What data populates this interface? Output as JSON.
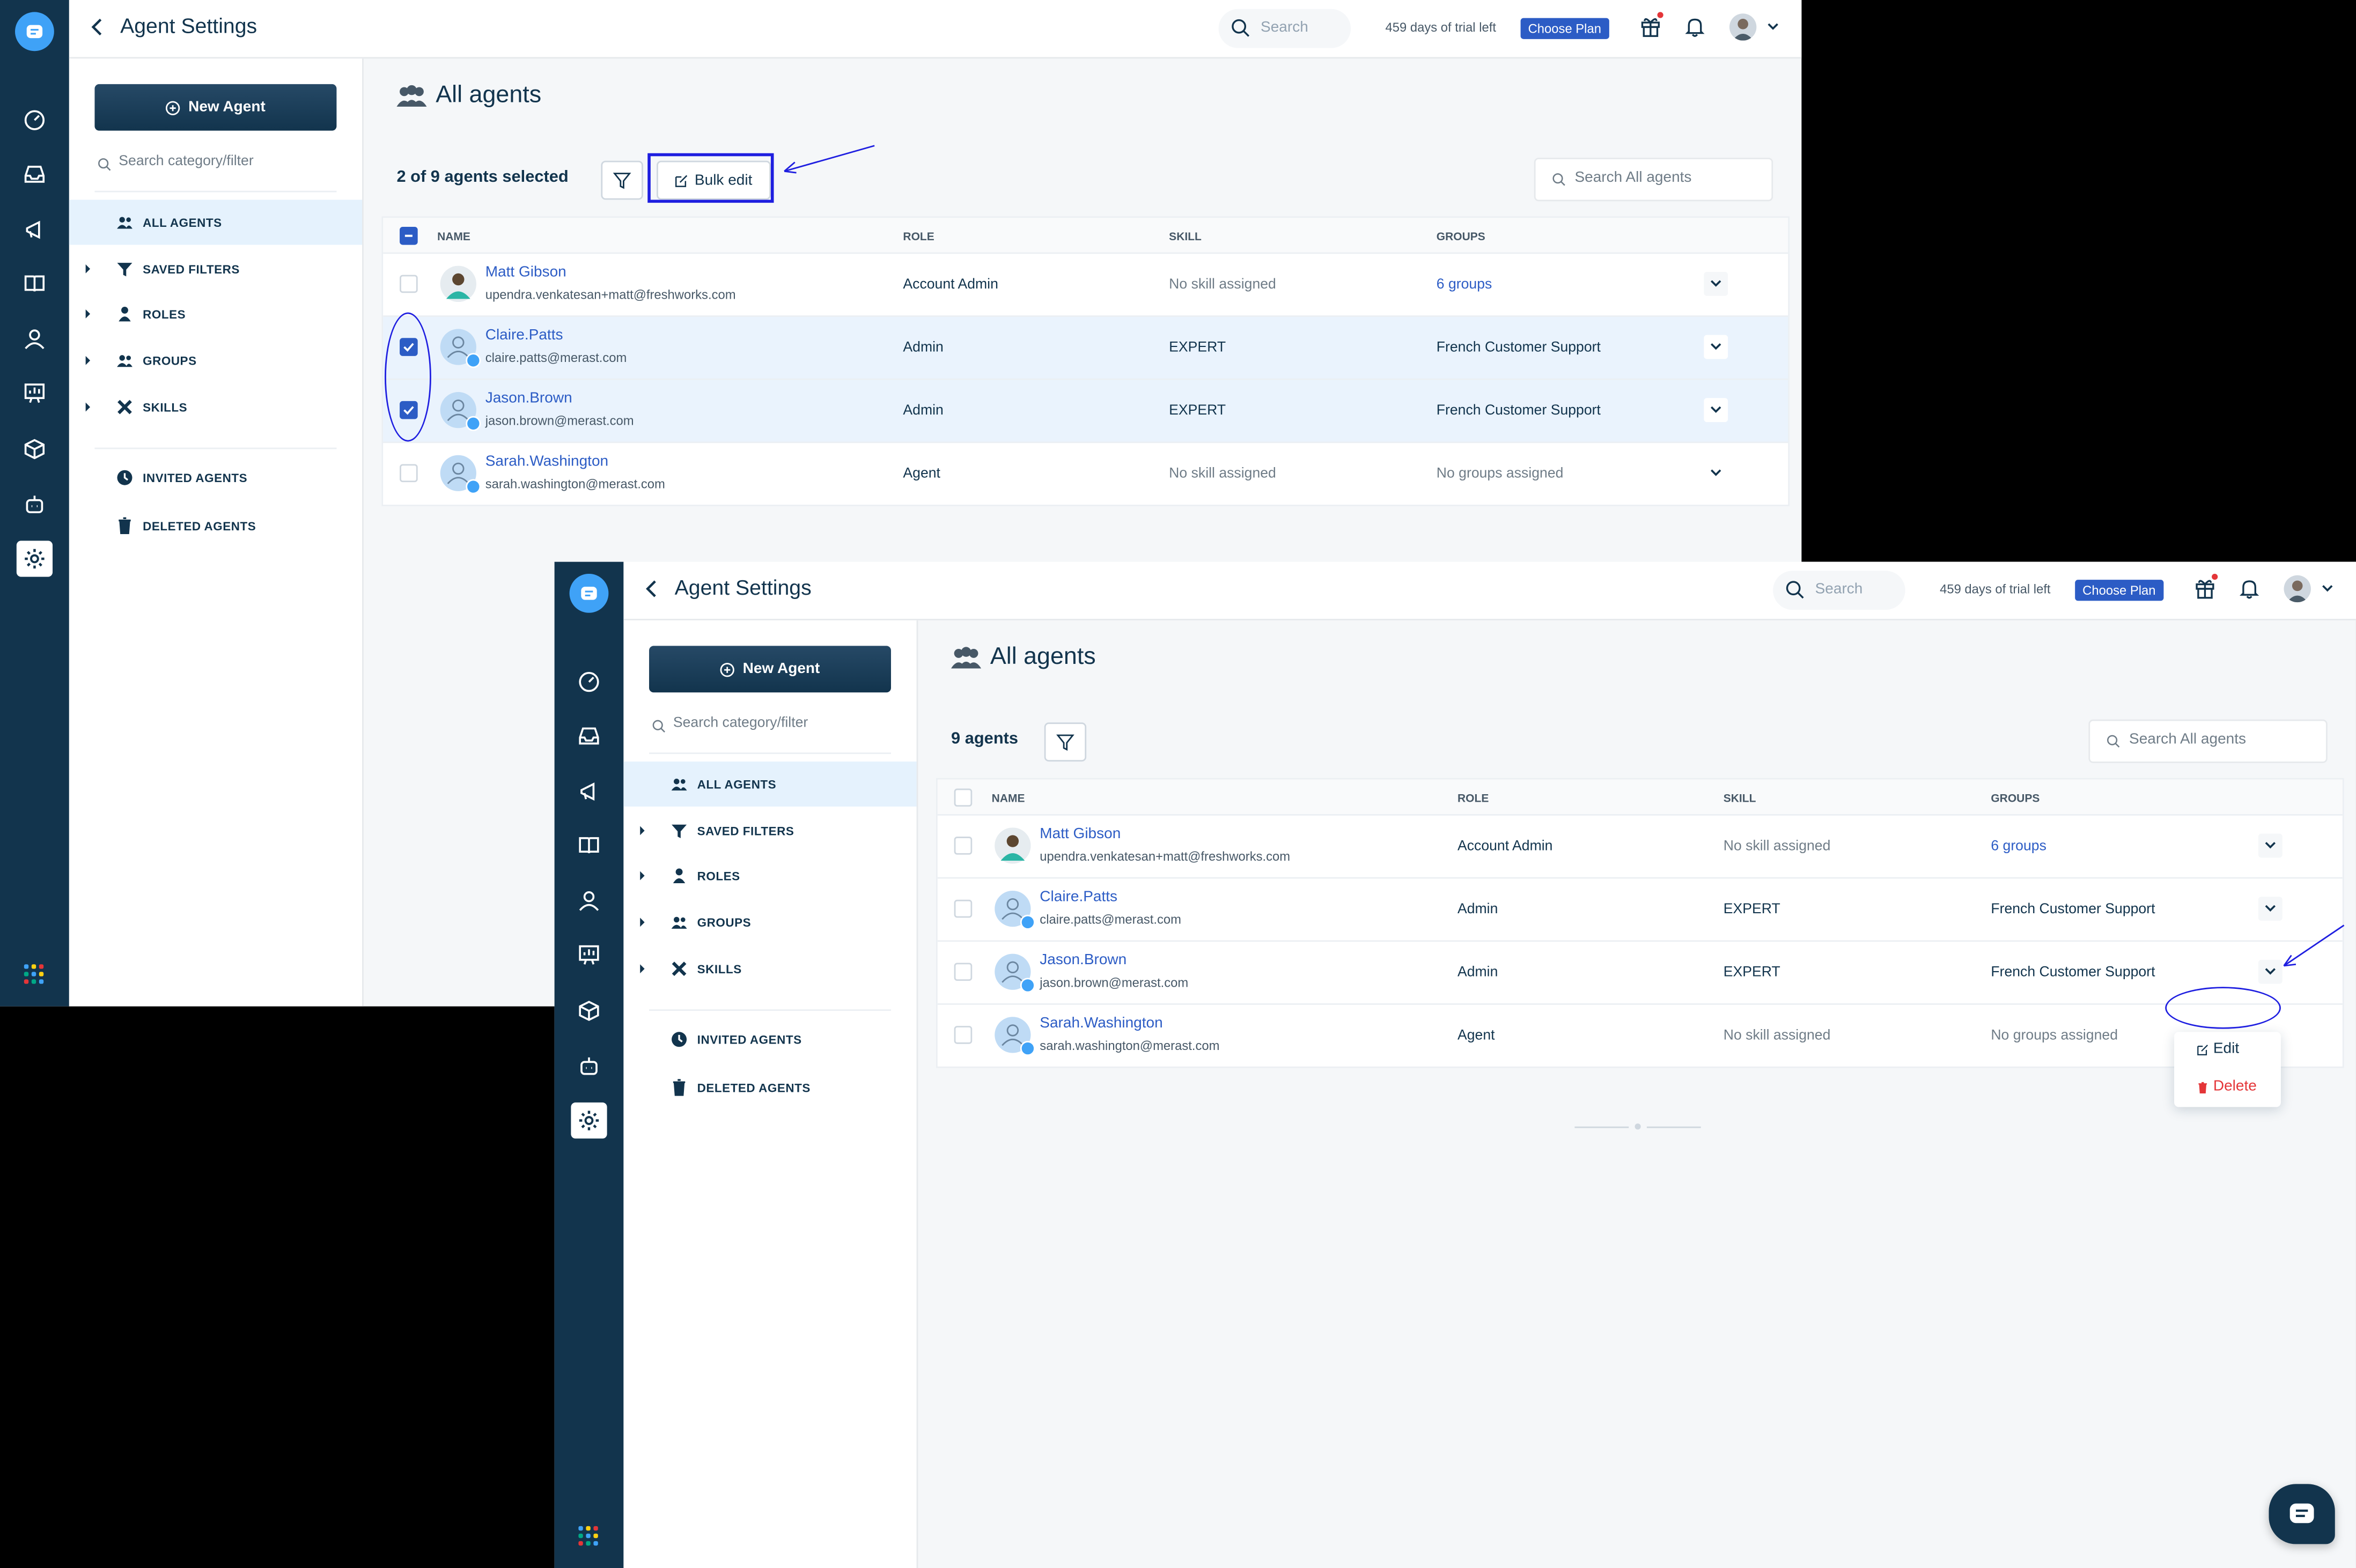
{
  "app": {
    "page_title": "Agent Settings",
    "search_placeholder": "Search",
    "trial_text": "459 days of trial left",
    "choose_plan": "Choose Plan"
  },
  "sidebar": {
    "new_agent": "New Agent",
    "search_placeholder": "Search category/filter",
    "items": [
      {
        "label": "ALL AGENTS",
        "icon": "users-icon"
      },
      {
        "label": "SAVED FILTERS",
        "icon": "funnel-icon"
      },
      {
        "label": "ROLES",
        "icon": "user-icon"
      },
      {
        "label": "GROUPS",
        "icon": "users-icon"
      },
      {
        "label": "SKILLS",
        "icon": "tools-icon"
      }
    ],
    "extra": [
      {
        "label": "INVITED AGENTS",
        "icon": "clock-icon"
      },
      {
        "label": "DELETED AGENTS",
        "icon": "trash-icon"
      }
    ]
  },
  "main": {
    "title": "All agents",
    "search_placeholder": "Search All agents",
    "bulk_edit": "Bulk edit",
    "columns": [
      "NAME",
      "ROLE",
      "SKILL",
      "GROUPS"
    ],
    "agents": [
      {
        "name": "Matt Gibson",
        "email": "upendra.venkatesan+matt@freshworks.com",
        "role": "Account Admin",
        "skill": "No skill assigned",
        "groups": "6 groups"
      },
      {
        "name": "Claire.Patts",
        "email": "claire.patts@merast.com",
        "role": "Admin",
        "skill": "EXPERT",
        "groups": "French Customer Support"
      },
      {
        "name": "Jason.Brown",
        "email": "jason.brown@merast.com",
        "role": "Admin",
        "skill": "EXPERT",
        "groups": "French Customer Support"
      },
      {
        "name": "Sarah.Washington",
        "email": "sarah.washington@merast.com",
        "role": "Agent",
        "skill": "No skill assigned",
        "groups": "No groups assigned"
      }
    ]
  },
  "shot1": {
    "count_label": "2 of 9 agents selected",
    "selected_rows": [
      1,
      2
    ]
  },
  "shot2": {
    "count_label": "9 agents"
  },
  "row_menu": {
    "edit": "Edit",
    "delete": "Delete"
  },
  "colors": {
    "rail": "#12344d",
    "accent": "#2c5cc5",
    "annotation": "#1e1ee0",
    "danger": "#e43538"
  }
}
